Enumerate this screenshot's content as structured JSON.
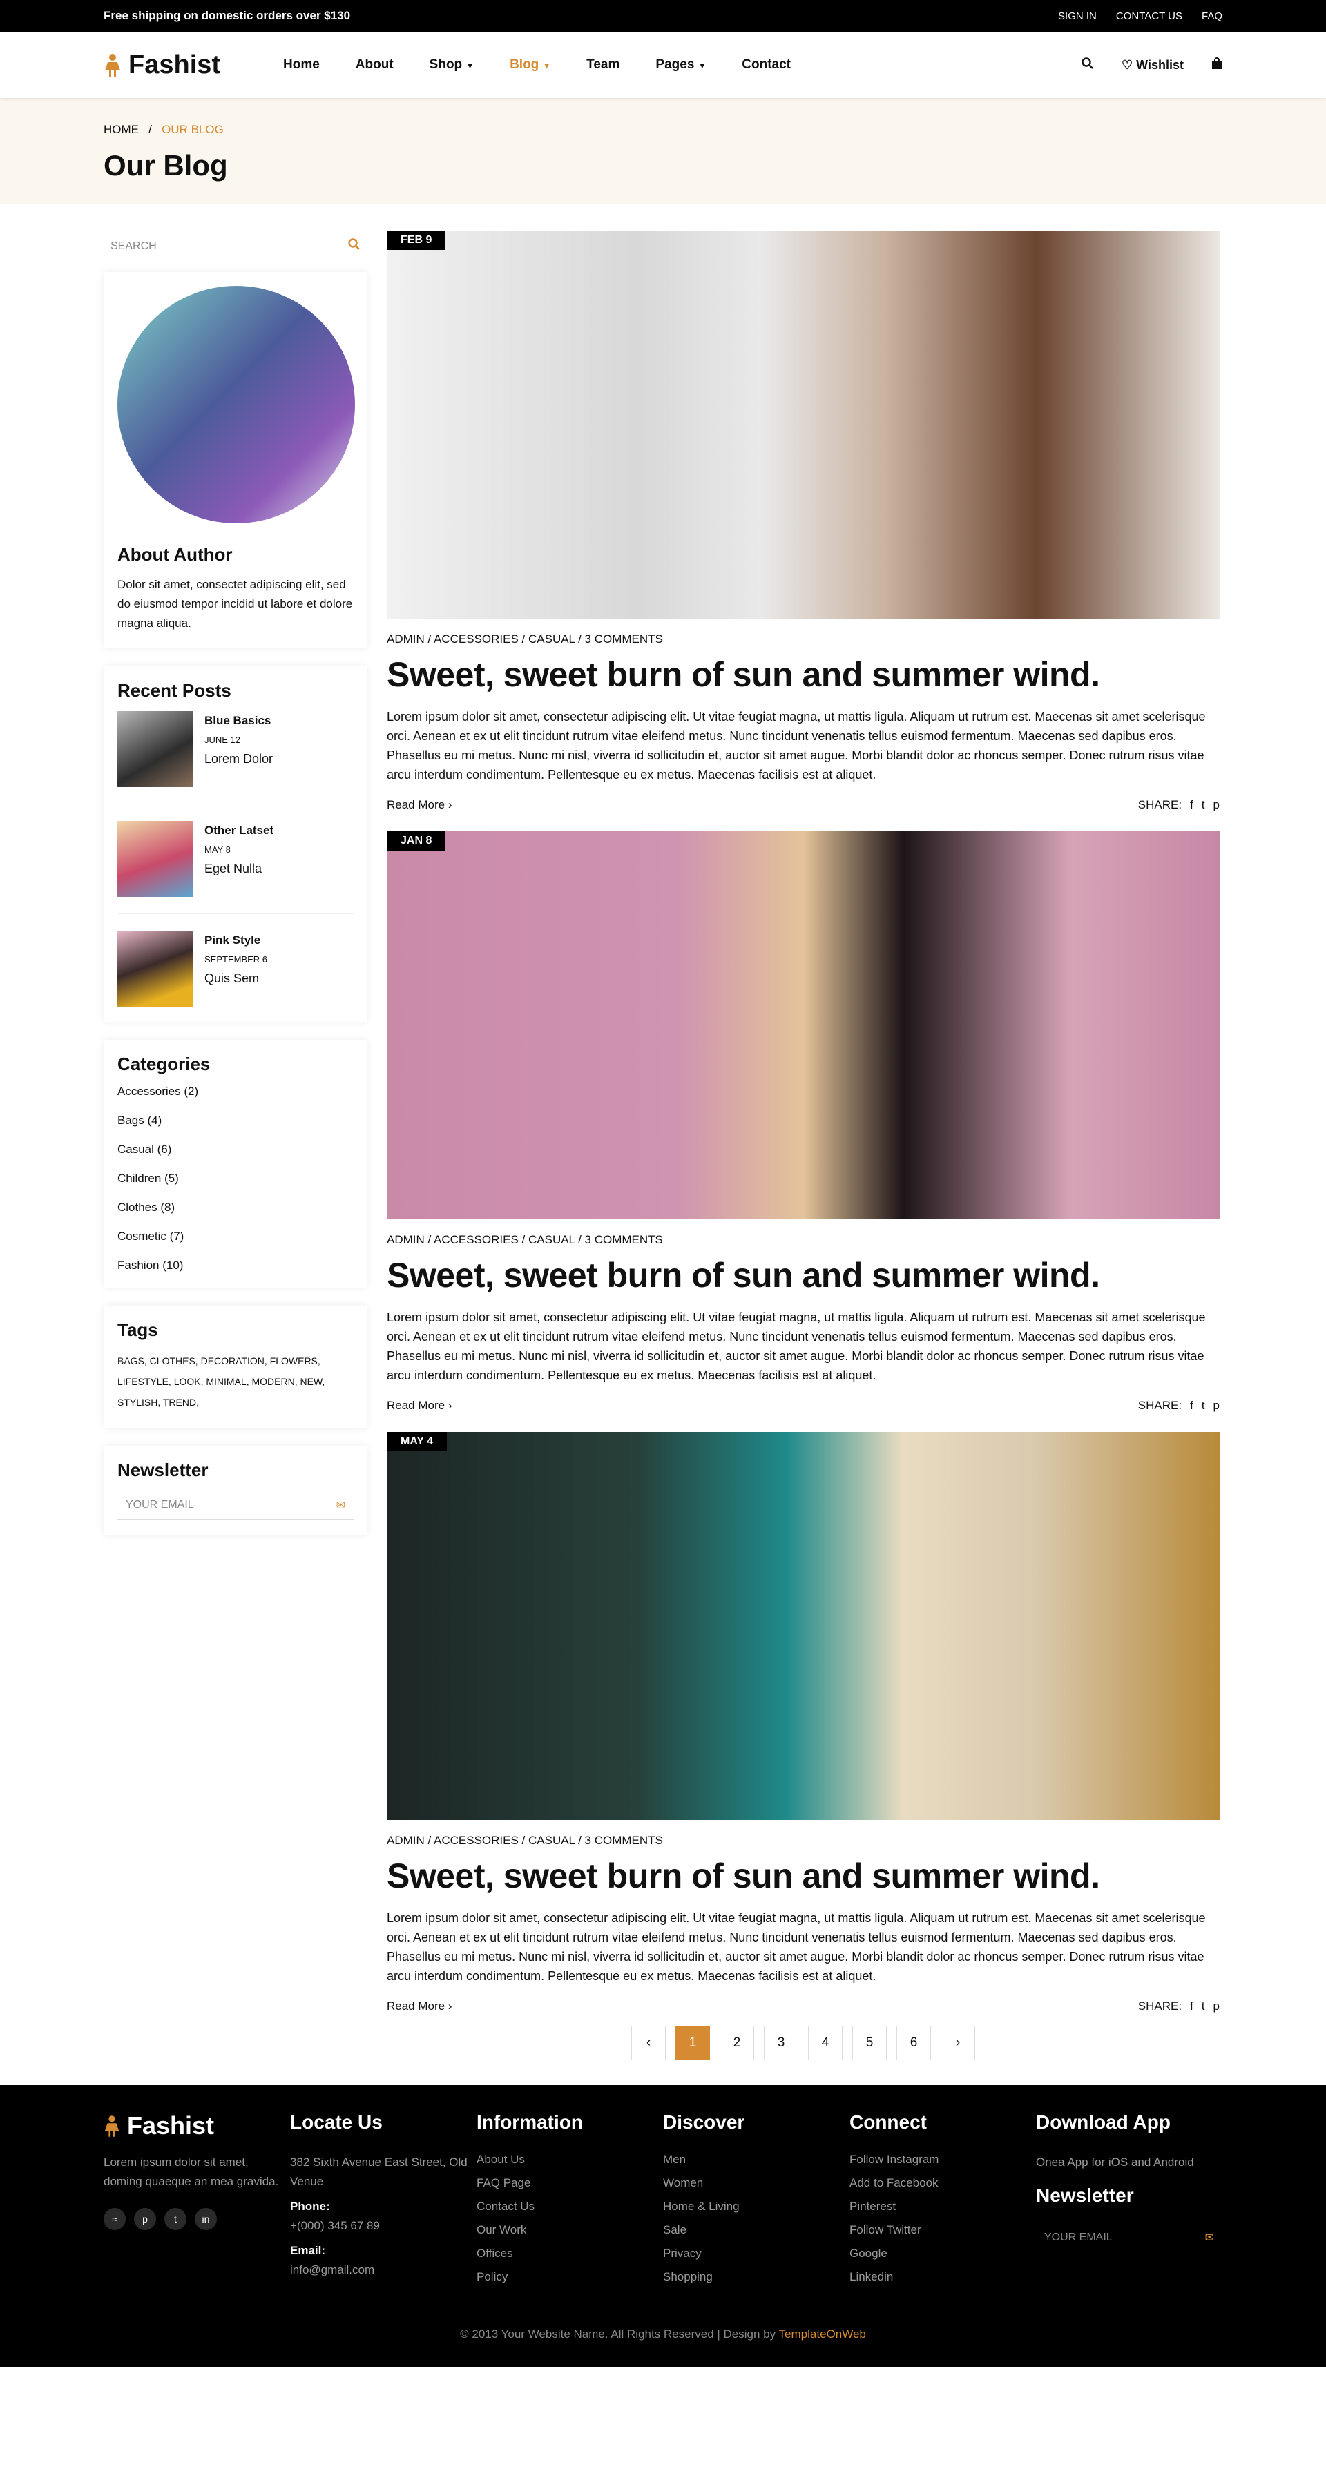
{
  "topbar": {
    "promo": "Free shipping on domestic orders over $130",
    "links": [
      "SIGN IN",
      "CONTACT US",
      "FAQ"
    ]
  },
  "brand": {
    "name": "Fashist",
    "accent": "#d68a32"
  },
  "nav": {
    "items": [
      "Home",
      "About",
      "Shop",
      "Blog",
      "Team",
      "Pages",
      "Contact"
    ],
    "wishlist": "Wishlist"
  },
  "breadcrumb": {
    "home": "HOME",
    "sep": "/",
    "current": "OUR BLOG"
  },
  "page_title": "Our Blog",
  "sidebar": {
    "search_placeholder": "SEARCH",
    "about": {
      "title": "About Author",
      "text": "Dolor sit amet, consectet adipiscing elit, sed do eiusmod tempor incidid ut labore et dolore magna aliqua."
    },
    "recent": {
      "title": "Recent Posts",
      "posts": [
        {
          "title": "Blue Basics",
          "date": "JUNE 12",
          "excerpt": "Lorem Dolor"
        },
        {
          "title": "Other Latset",
          "date": "MAY 8",
          "excerpt": "Eget Nulla"
        },
        {
          "title": "Pink Style",
          "date": "SEPTEMBER 6",
          "excerpt": "Quis Sem"
        }
      ]
    },
    "categories": {
      "title": "Categories",
      "items": [
        "Accessories (2)",
        "Bags (4)",
        "Casual (6)",
        "Children (5)",
        "Clothes (8)",
        "Cosmetic (7)",
        "Fashion (10)"
      ]
    },
    "tags": {
      "title": "Tags",
      "text": "BAGS, CLOTHES, DECORATION, FLOWERS, LIFESTYLE, LOOK, MINIMAL, MODERN, NEW, STYLISH, TREND,"
    },
    "newsletter": {
      "title": "Newsletter",
      "placeholder": "YOUR EMAIL"
    }
  },
  "posts": [
    {
      "date": "FEB 9",
      "meta": "ADMIN / ACCESSORIES / CASUAL / 3 COMMENTS",
      "title": "Sweet, sweet burn of sun and summer wind.",
      "body": "Lorem ipsum dolor sit amet, consectetur adipiscing elit. Ut vitae feugiat magna, ut mattis ligula. Aliquam ut rutrum est. Maecenas sit amet scelerisque orci. Aenean et ex ut elit tincidunt rutrum vitae eleifend metus. Nunc tincidunt venenatis tellus euismod fermentum. Maecenas sed dapibus eros. Phasellus eu mi metus. Nunc mi nisl, viverra id sollicitudin et, auctor sit amet augue. Morbi blandit dolor ac rhoncus semper. Donec rutrum risus vitae arcu interdum condimentum. Pellentesque eu ex metus. Maecenas facilisis est at aliquet.",
      "read_more": "Read More",
      "share": "SHARE:"
    },
    {
      "date": "JAN 8",
      "meta": "ADMIN / ACCESSORIES / CASUAL / 3 COMMENTS",
      "title": "Sweet, sweet burn of sun and summer wind.",
      "body": "Lorem ipsum dolor sit amet, consectetur adipiscing elit. Ut vitae feugiat magna, ut mattis ligula. Aliquam ut rutrum est. Maecenas sit amet scelerisque orci. Aenean et ex ut elit tincidunt rutrum vitae eleifend metus. Nunc tincidunt venenatis tellus euismod fermentum. Maecenas sed dapibus eros. Phasellus eu mi metus. Nunc mi nisl, viverra id sollicitudin et, auctor sit amet augue. Morbi blandit dolor ac rhoncus semper. Donec rutrum risus vitae arcu interdum condimentum. Pellentesque eu ex metus. Maecenas facilisis est at aliquet.",
      "read_more": "Read More",
      "share": "SHARE:"
    },
    {
      "date": "MAY 4",
      "meta": "ADMIN / ACCESSORIES / CASUAL / 3 COMMENTS",
      "title": "Sweet, sweet burn of sun and summer wind.",
      "body": "Lorem ipsum dolor sit amet, consectetur adipiscing elit. Ut vitae feugiat magna, ut mattis ligula. Aliquam ut rutrum est. Maecenas sit amet scelerisque orci. Aenean et ex ut elit tincidunt rutrum vitae eleifend metus. Nunc tincidunt venenatis tellus euismod fermentum. Maecenas sed dapibus eros. Phasellus eu mi metus. Nunc mi nisl, viverra id sollicitudin et, auctor sit amet augue. Morbi blandit dolor ac rhoncus semper. Donec rutrum risus vitae arcu interdum condimentum. Pellentesque eu ex metus. Maecenas facilisis est at aliquet.",
      "read_more": "Read More",
      "share": "SHARE:"
    }
  ],
  "pagination": {
    "pages": [
      "1",
      "2",
      "3",
      "4",
      "5",
      "6"
    ],
    "current": "1"
  },
  "footer": {
    "about": "Lorem ipsum dolor sit amet, doming quaeque an mea gravida.",
    "locate": {
      "title": "Locate Us",
      "address": "382 Sixth Avenue East Street, Old Venue",
      "phone_label": "Phone:",
      "phone": "+(000) 345 67 89",
      "email_label": "Email:",
      "email": "info@gmail.com"
    },
    "information": {
      "title": "Information",
      "links": [
        "About Us",
        "FAQ Page",
        "Contact Us",
        "Our Work",
        "Offices",
        "Policy"
      ]
    },
    "discover": {
      "title": "Discover",
      "links": [
        "Men",
        "Women",
        "Home & Living",
        "Sale",
        "Privacy",
        "Shopping"
      ]
    },
    "connect": {
      "title": "Connect",
      "links": [
        "Follow Instagram",
        "Add to Facebook",
        "Pinterest",
        "Follow Twitter",
        "Google",
        "Linkedin"
      ]
    },
    "app": {
      "title": "Download App",
      "text": "Onea App for iOS and Android",
      "newsletter_title": "Newsletter",
      "placeholder": "YOUR EMAIL"
    },
    "copyright": "© 2013 Your Website Name. All Rights Reserved | Design by",
    "designer": "TemplateOnWeb"
  }
}
